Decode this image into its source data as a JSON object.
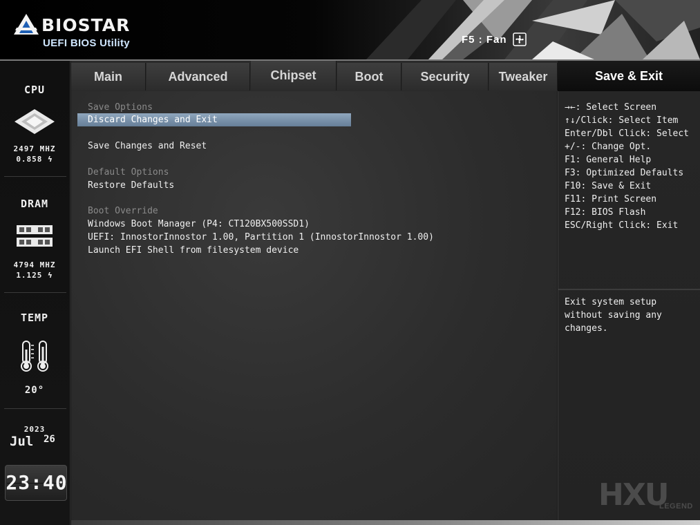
{
  "header": {
    "brand": "BIOSTAR",
    "subtitle": "UEFI BIOS Utility",
    "fan_hint": "F5 : Fan"
  },
  "sidebar": {
    "cpu": {
      "label": "CPU",
      "freq": "2497 MHZ",
      "volt": "0.858 ϟ"
    },
    "dram": {
      "label": "DRAM",
      "freq": "4794 MHZ",
      "volt": "1.125 ϟ"
    },
    "temp": {
      "label": "TEMP",
      "value": "20°"
    },
    "date": {
      "year": "2023",
      "month": "Jul",
      "day": "26"
    },
    "clock": "23:40"
  },
  "tabs": [
    {
      "label": "Main"
    },
    {
      "label": "Advanced"
    },
    {
      "label": "Chipset"
    },
    {
      "label": "Boot"
    },
    {
      "label": "Security"
    },
    {
      "label": "Tweaker"
    }
  ],
  "active_tab": {
    "label": "Save & Exit"
  },
  "menu": {
    "save_options_header": "Save Options",
    "discard_changes_exit": "Discard Changes and Exit",
    "save_changes_reset": "Save Changes and Reset",
    "default_options_header": "Default Options",
    "restore_defaults": "Restore Defaults",
    "boot_override_header": "Boot Override",
    "boot_items": [
      "Windows Boot Manager (P4: CT120BX500SSD1)",
      "UEFI: InnostorInnostor 1.00, Partition 1 (InnostorInnostor 1.00)",
      "Launch EFI Shell from filesystem device"
    ]
  },
  "help": {
    "keys": [
      "→←: Select Screen",
      "↑↓/Click: Select Item",
      "Enter/Dbl Click: Select",
      "+/-: Change Opt.",
      "F1: General Help",
      "F3: Optimized Defaults",
      "F10: Save & Exit",
      "F11: Print Screen",
      "F12: BIOS Flash",
      "ESC/Right Click: Exit"
    ],
    "description": [
      "Exit system setup",
      "without saving any",
      "changes."
    ]
  },
  "watermark": {
    "main": "HXU",
    "sub": "LEGEND"
  }
}
